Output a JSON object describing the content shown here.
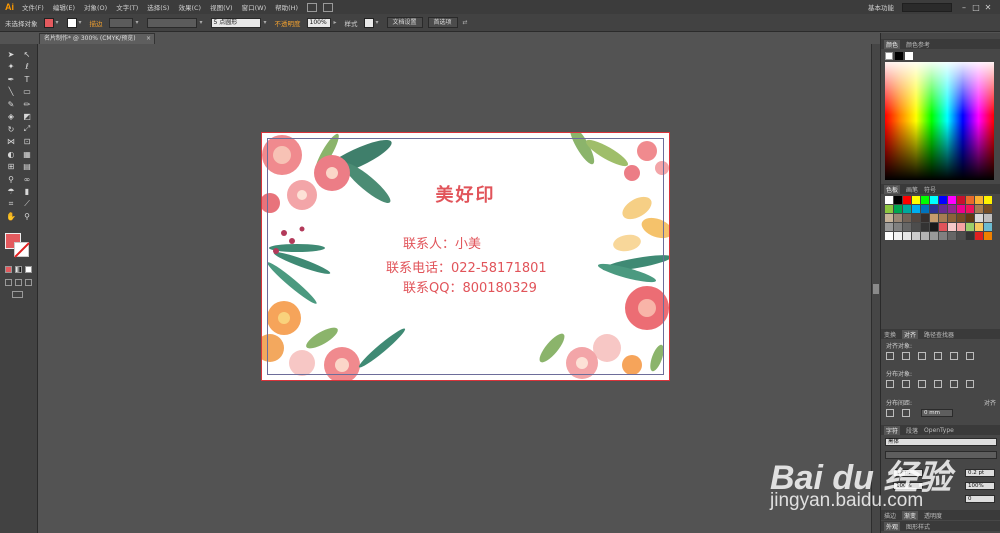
{
  "app": {
    "logo": "Ai"
  },
  "menu": [
    "文件(F)",
    "编辑(E)",
    "对象(O)",
    "文字(T)",
    "选择(S)",
    "效果(C)",
    "视图(V)",
    "窗口(W)",
    "帮助(H)"
  ],
  "workspace": "基本功能",
  "window_controls": [
    "–",
    "□",
    "✕"
  ],
  "controlbar": {
    "selection": "未选择对象",
    "stroke_label": "描边",
    "brush_value": "5 点圆形",
    "opacity_label": "不透明度",
    "opacity_value": "100%",
    "style_label": "样式",
    "doc_setup": "文档设置",
    "preferences": "首选项"
  },
  "doc_tab": {
    "title": "名片制作* @ 300% (CMYK/预览)",
    "close": "×"
  },
  "card": {
    "title": "美好印",
    "contact": "联系人：小美",
    "phone": "联系电话：022-58171801",
    "qq": "联系QQ：800180329"
  },
  "panels": {
    "color_tabs": [
      "颜色",
      "颜色参考"
    ],
    "swatch_tabs": [
      "色板",
      "画笔",
      "符号"
    ],
    "align_tabs": [
      "变换",
      "对齐",
      "路径查找器"
    ],
    "align_objects": "对齐对象:",
    "distribute_objects": "分布对象:",
    "distribute_spacing": "分布间距:",
    "align_to": "对齐",
    "spacing_value": "0 mm",
    "char_tabs": [
      "字符",
      "段落",
      "OpenType"
    ],
    "font_name": "黑体",
    "font_size": "12 pt",
    "leading": "0.2 pt",
    "scale_h": "100%",
    "scale_v": "100%",
    "tracking": "0",
    "bottom_tabs_1": [
      "描边",
      "渐变",
      "透明度"
    ],
    "bottom_tabs_2": [
      "外观",
      "图形样式"
    ]
  },
  "watermark": {
    "brand": "Bai du 经验",
    "url": "jingyan.baidu.com"
  },
  "colors": {
    "accent_red": "#e1545a",
    "fill_swatch": "#e45a5e",
    "swatches": [
      "#ffffff",
      "#000000",
      "#ff0000",
      "#ffff00",
      "#00ff00",
      "#00ffff",
      "#0000ff",
      "#ff00ff",
      "#c8102e",
      "#e86a2b",
      "#f9b233",
      "#fff200",
      "#8dc63f",
      "#00a651",
      "#00a99d",
      "#00aeef",
      "#0072bc",
      "#2e3192",
      "#662d91",
      "#92278f",
      "#ec008c",
      "#ed145b",
      "#a67c52",
      "#754c24",
      "#c7b299",
      "#998675",
      "#736357",
      "#534741",
      "#362f2d",
      "#c69c6d",
      "#a67c52",
      "#8c6239",
      "#754c24",
      "#603913",
      "#d9d9d9",
      "#bfbfbf",
      "#999999",
      "#808080",
      "#666666",
      "#4d4d4d",
      "#333333",
      "#1a1a1a",
      "#e1545a",
      "#f7c9c9",
      "#f5a3a3",
      "#9ccf6b",
      "#f6c85f",
      "#6bbbd1",
      "#ffffff",
      "#f2f2f2",
      "#e6e6e6",
      "#cccccc",
      "#b3b3b3",
      "#999999",
      "#808080",
      "#666666",
      "#4d4d4d",
      "#333333",
      "#e02020",
      "#f08000"
    ]
  }
}
